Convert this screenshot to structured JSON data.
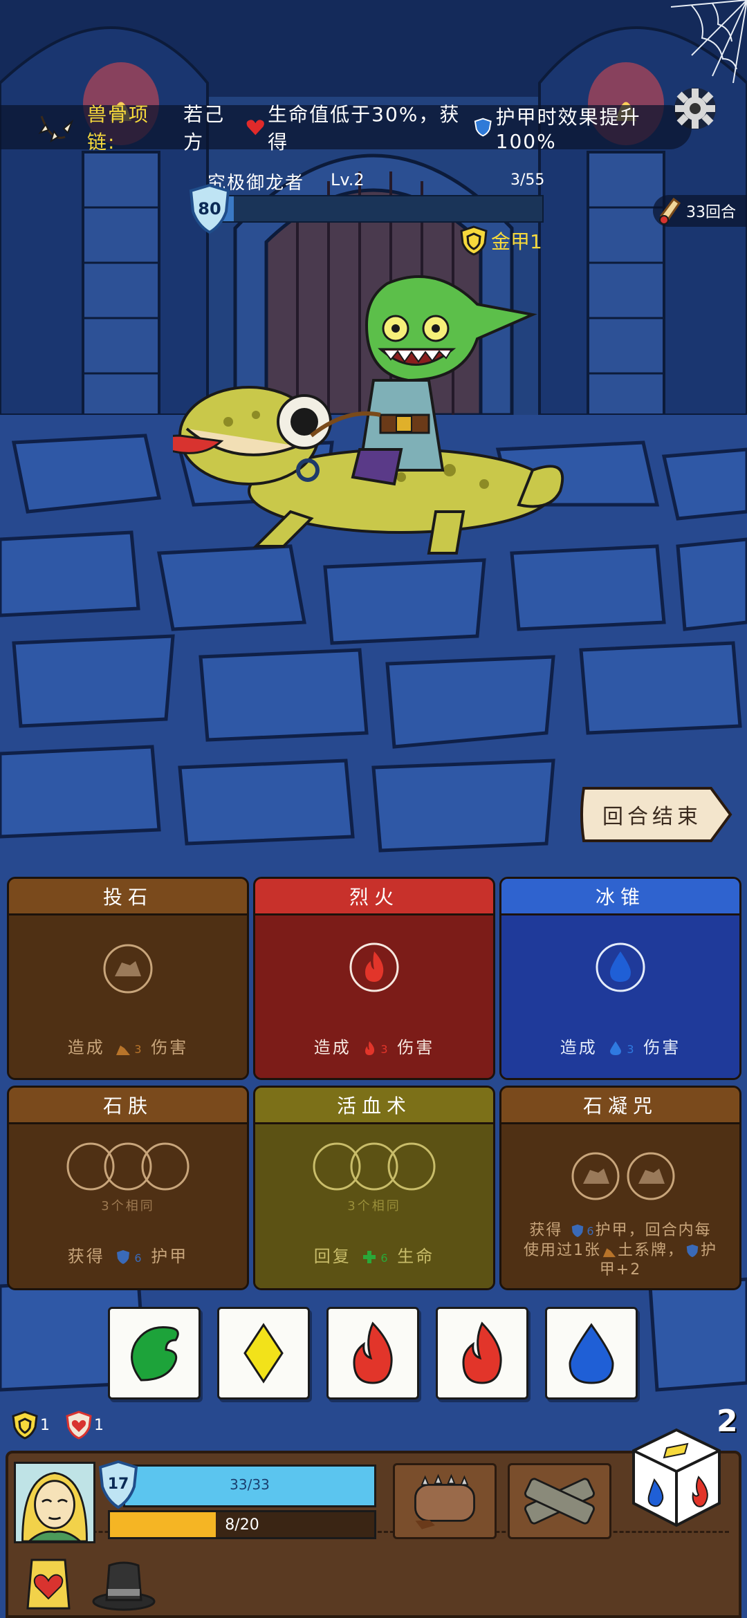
{
  "relic": {
    "name": "兽骨项链:",
    "text_before": "若己方",
    "text_middle": "生命值低于30%，获得",
    "text_after": "护甲时效果提升100%",
    "icon": "bone-necklace-icon"
  },
  "enemy": {
    "name": "究极御龙者",
    "level": "Lv.2",
    "hp_text": "3/55",
    "hp_fraction": 0.055,
    "shield": "80",
    "status_label": "金甲1"
  },
  "round": {
    "label": "33回合"
  },
  "end_turn": {
    "label": "回合结束"
  },
  "cards": [
    {
      "id": "throw-stone",
      "title": "投石",
      "desc_before": "造成",
      "value": "3",
      "desc_after": "伤害",
      "element": "earth",
      "slots": 1
    },
    {
      "id": "blaze",
      "title": "烈火",
      "desc_before": "造成",
      "value": "3",
      "desc_after": "伤害",
      "element": "fire",
      "slots": 1
    },
    {
      "id": "ice-cone",
      "title": "冰锥",
      "desc_before": "造成",
      "value": "3",
      "desc_after": "伤害",
      "element": "water",
      "slots": 1
    },
    {
      "id": "stone-skin",
      "title": "石肤",
      "slot_label": "3个相同",
      "desc_before": "获得",
      "value": "6",
      "desc_after": "护甲",
      "element": "earth",
      "slots": 3
    },
    {
      "id": "blood-magic",
      "title": "活血术",
      "slot_label": "3个相同",
      "desc_before": "回复",
      "value": "6",
      "desc_after": "生命",
      "element": "life",
      "slots": 3
    },
    {
      "id": "stone-curse",
      "title": "石凝咒",
      "desc_line1": "获得",
      "value": "6",
      "desc_line1b": "护甲，回合内每",
      "desc_line2a": "使用过1张",
      "desc_line2b": "土系牌，",
      "desc_line2c": "护",
      "desc_line3": "甲+2",
      "element": "earth",
      "slots": 2
    }
  ],
  "dice": [
    {
      "face": "leaf",
      "color": "#1da33a"
    },
    {
      "face": "diamond",
      "color": "#f2e21a"
    },
    {
      "face": "fire",
      "color": "#e2352a"
    },
    {
      "face": "fire",
      "color": "#e2352a"
    },
    {
      "face": "water",
      "color": "#1f5fd6"
    }
  ],
  "player": {
    "armor_status": "1",
    "heart_status": "1",
    "shield": "17",
    "hp_text": "33/33",
    "energy_text": "8/20",
    "energy_fraction": 0.4,
    "dice_count": "2"
  },
  "colors": {
    "accent_gold": "#f6d93c",
    "hp_blue": "#5bc5ef",
    "energy_yellow": "#f5b524"
  }
}
